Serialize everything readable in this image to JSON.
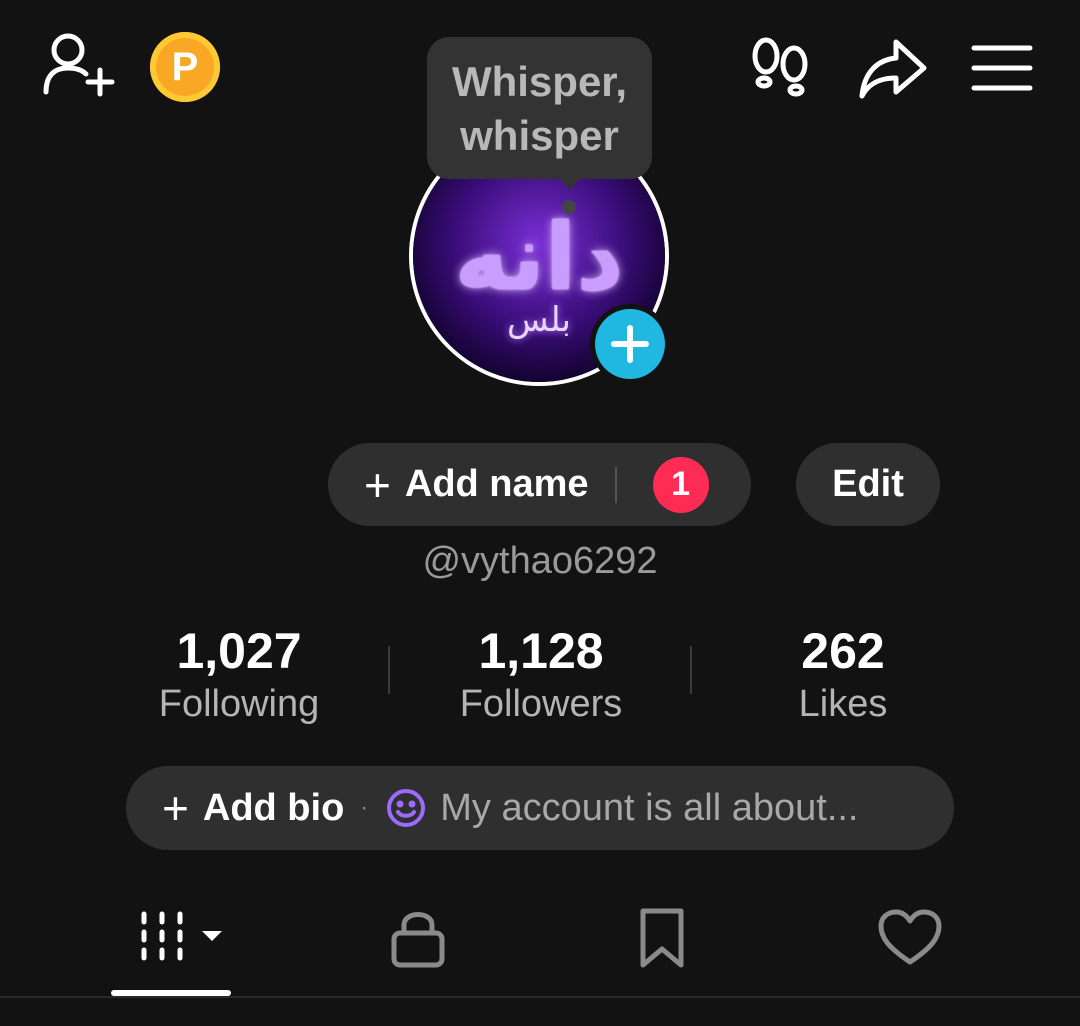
{
  "colors": {
    "background": "#121212",
    "button_bg": "#2f2f2f",
    "badge_red": "#fe2c55",
    "coin_orange": "#f9a825",
    "avatar_plus_blue": "#20b8e0",
    "bio_emoji_purple": "#9c6bff"
  },
  "header": {
    "coin_letter": "P",
    "icons": [
      "add-friend-icon",
      "coin-icon",
      "footprint-icon",
      "share-icon",
      "menu-icon"
    ]
  },
  "tooltip": {
    "line1": "Whisper,",
    "line2": "whisper"
  },
  "avatar": {
    "logo_main": "دانه",
    "logo_sub": "بلس"
  },
  "profile": {
    "add_name_label": "Add name",
    "add_name_badge": "1",
    "edit_label": "Edit",
    "username": "@vythao6292"
  },
  "stats": [
    {
      "value": "1,027",
      "label": "Following"
    },
    {
      "value": "1,128",
      "label": "Followers"
    },
    {
      "value": "262",
      "label": "Likes"
    }
  ],
  "bio": {
    "add_label": "Add bio",
    "separator": "·",
    "placeholder": "My account is all about..."
  },
  "tabs": {
    "selected": "videos",
    "icons": [
      "videos-grid-icon",
      "lock-icon",
      "bookmark-icon",
      "heart-icon"
    ]
  }
}
